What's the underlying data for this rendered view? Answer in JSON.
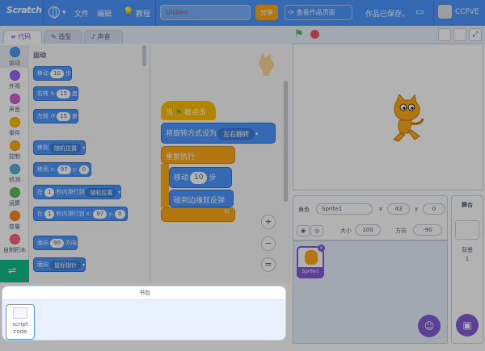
{
  "menubar": {
    "logo": "Scratch",
    "file": "文件",
    "edit": "编辑",
    "tutorials": "教程",
    "title_placeholder": "Untitled",
    "share": "分享",
    "see_project": "查看作品页面",
    "saved": "作品已保存。",
    "username": "CCFVE"
  },
  "tabs": {
    "code": "代码",
    "costumes": "造型",
    "sounds": "声音"
  },
  "categories": [
    {
      "label": "运动",
      "color": "#4c97ff"
    },
    {
      "label": "外观",
      "color": "#9966ff"
    },
    {
      "label": "声音",
      "color": "#cf63cf"
    },
    {
      "label": "事件",
      "color": "#ffbf00"
    },
    {
      "label": "控制",
      "color": "#ffab19"
    },
    {
      "label": "侦测",
      "color": "#5cb1d6"
    },
    {
      "label": "运算",
      "color": "#59c059"
    },
    {
      "label": "变量",
      "color": "#ff8c1a"
    },
    {
      "label": "自制积木",
      "color": "#ff6680"
    }
  ],
  "palette": {
    "heading": "运动",
    "move": {
      "a": "移动",
      "v": "10",
      "b": "步"
    },
    "turn_right": {
      "a": "右转",
      "v": "15",
      "b": "度"
    },
    "turn_left": {
      "a": "左转",
      "v": "15",
      "b": "度"
    },
    "goto": {
      "a": "移到",
      "dd": "随机位置"
    },
    "gotoxy": {
      "a": "移到 x:",
      "x": "97",
      "b": "y:",
      "y": "0"
    },
    "glide": {
      "a": "在",
      "v": "1",
      "b": "秒内滑行到",
      "dd": "随机位置"
    },
    "glidexy": {
      "a": "在",
      "v": "1",
      "b": "秒内滑行到 x:",
      "x": "97",
      "c": "y:",
      "y": "0"
    },
    "point": {
      "a": "面向",
      "v": "90",
      "b": "方向"
    },
    "pointto": {
      "a": "面向",
      "dd": "鼠标指针"
    }
  },
  "script": {
    "hat_when": "当",
    "hat_clicked": "被点击",
    "rotation": {
      "a": "将旋转方式设为",
      "dd": "左右翻转"
    },
    "forever": "重复执行",
    "move": {
      "a": "移动",
      "v": "10",
      "b": "步"
    },
    "bounce": "碰到边缘就反弹"
  },
  "sprite": {
    "label_sprite": "角色",
    "name": "Sprite1",
    "label_x": "x",
    "x": "43",
    "label_y": "y",
    "y": "0",
    "label_show": "显示",
    "label_size": "大小",
    "size": "100",
    "label_direction": "方向",
    "direction": "-90",
    "thumb_name": "Sprite1"
  },
  "stage_panel": {
    "title": "舞台",
    "backdrops_label": "背景",
    "backdrops_count": "1"
  },
  "backpack": {
    "title": "书包",
    "item_label": "script code"
  }
}
